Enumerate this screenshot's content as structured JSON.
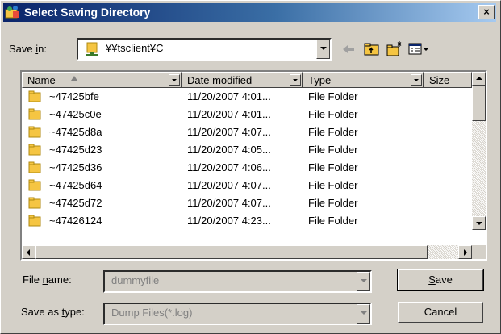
{
  "window": {
    "title": "Select Saving Directory",
    "close_glyph": "×"
  },
  "save_in": {
    "label_pre": "Save ",
    "label_key": "i",
    "label_post": "n:",
    "value": "¥¥tsclient¥C"
  },
  "toolbar": {
    "icons": [
      "back-arrow-icon",
      "up-folder-icon",
      "new-folder-icon",
      "view-menu-icon"
    ]
  },
  "columns": [
    "Name",
    "Date modified",
    "Type",
    "Size"
  ],
  "files": [
    {
      "name": "~47425bfe",
      "date": "11/20/2007 4:01...",
      "type": "File Folder"
    },
    {
      "name": "~47425c0e",
      "date": "11/20/2007 4:01...",
      "type": "File Folder"
    },
    {
      "name": "~47425d8a",
      "date": "11/20/2007 4:07...",
      "type": "File Folder"
    },
    {
      "name": "~47425d23",
      "date": "11/20/2007 4:05...",
      "type": "File Folder"
    },
    {
      "name": "~47425d36",
      "date": "11/20/2007 4:06...",
      "type": "File Folder"
    },
    {
      "name": "~47425d64",
      "date": "11/20/2007 4:07...",
      "type": "File Folder"
    },
    {
      "name": "~47425d72",
      "date": "11/20/2007 4:07...",
      "type": "File Folder"
    },
    {
      "name": "~47426124",
      "date": "11/20/2007 4:23...",
      "type": "File Folder"
    }
  ],
  "file_name": {
    "label_pre": "File ",
    "label_key": "n",
    "label_post": "ame:",
    "value": "dummyfile"
  },
  "save_type": {
    "label_pre": "Save as ",
    "label_key": "t",
    "label_post": "ype:",
    "value": "Dump Files(*.log)"
  },
  "buttons": {
    "save_key": "S",
    "save_rest": "ave",
    "cancel": "Cancel"
  },
  "colors": {
    "title_start": "#0a246a",
    "title_end": "#a6caf0",
    "face": "#d4d0c8",
    "folder": "#f5c542"
  }
}
